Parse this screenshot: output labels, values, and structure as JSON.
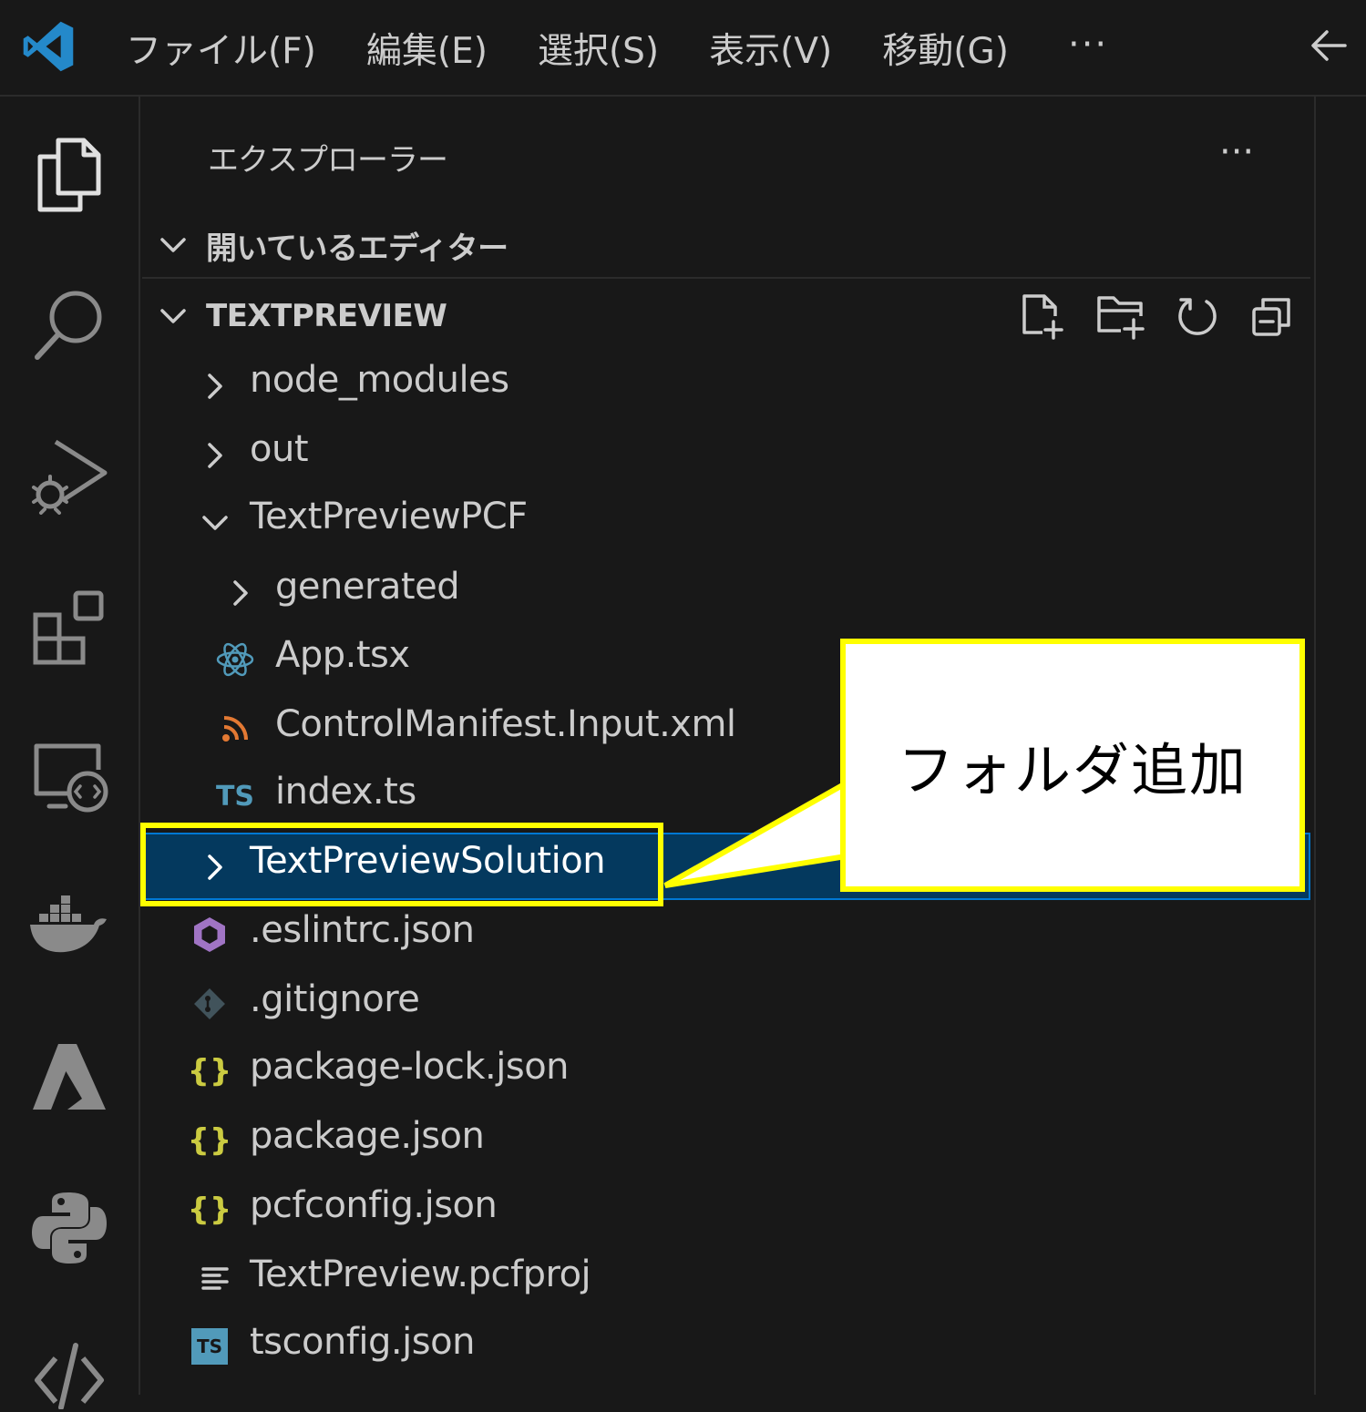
{
  "menu": {
    "items": [
      "ファイル(F)",
      "編集(E)",
      "選択(S)",
      "表示(V)",
      "移動(G)"
    ],
    "more": "···"
  },
  "sidebar": {
    "title": "エクスプローラー",
    "more": "···",
    "open_editors_label": "開いているエディター",
    "project_label": "TEXTPREVIEW"
  },
  "tree": {
    "node_modules": "node_modules",
    "out": "out",
    "textpreviewpcf": "TextPreviewPCF",
    "generated": "generated",
    "app_tsx": "App.tsx",
    "manifest": "ControlManifest.Input.xml",
    "index_ts": "index.ts",
    "solution": "TextPreviewSolution",
    "eslintrc": ".eslintrc.json",
    "gitignore": ".gitignore",
    "package_lock": "package-lock.json",
    "package_json": "package.json",
    "pcfconfig": "pcfconfig.json",
    "pcfproj": "TextPreview.pcfproj",
    "tsconfig": "tsconfig.json"
  },
  "icons": {
    "ts_text": "TS"
  },
  "annotation": {
    "text": "フォルダ追加"
  },
  "colors": {
    "background": "#181818",
    "selection": "#04395e",
    "highlight": "#ffff00",
    "vscode_blue": "#2489ca",
    "json_yellow": "#cbcb41",
    "ts_blue": "#519aba",
    "xml_orange": "#e37933",
    "eslint_purple": "#a074c4"
  }
}
